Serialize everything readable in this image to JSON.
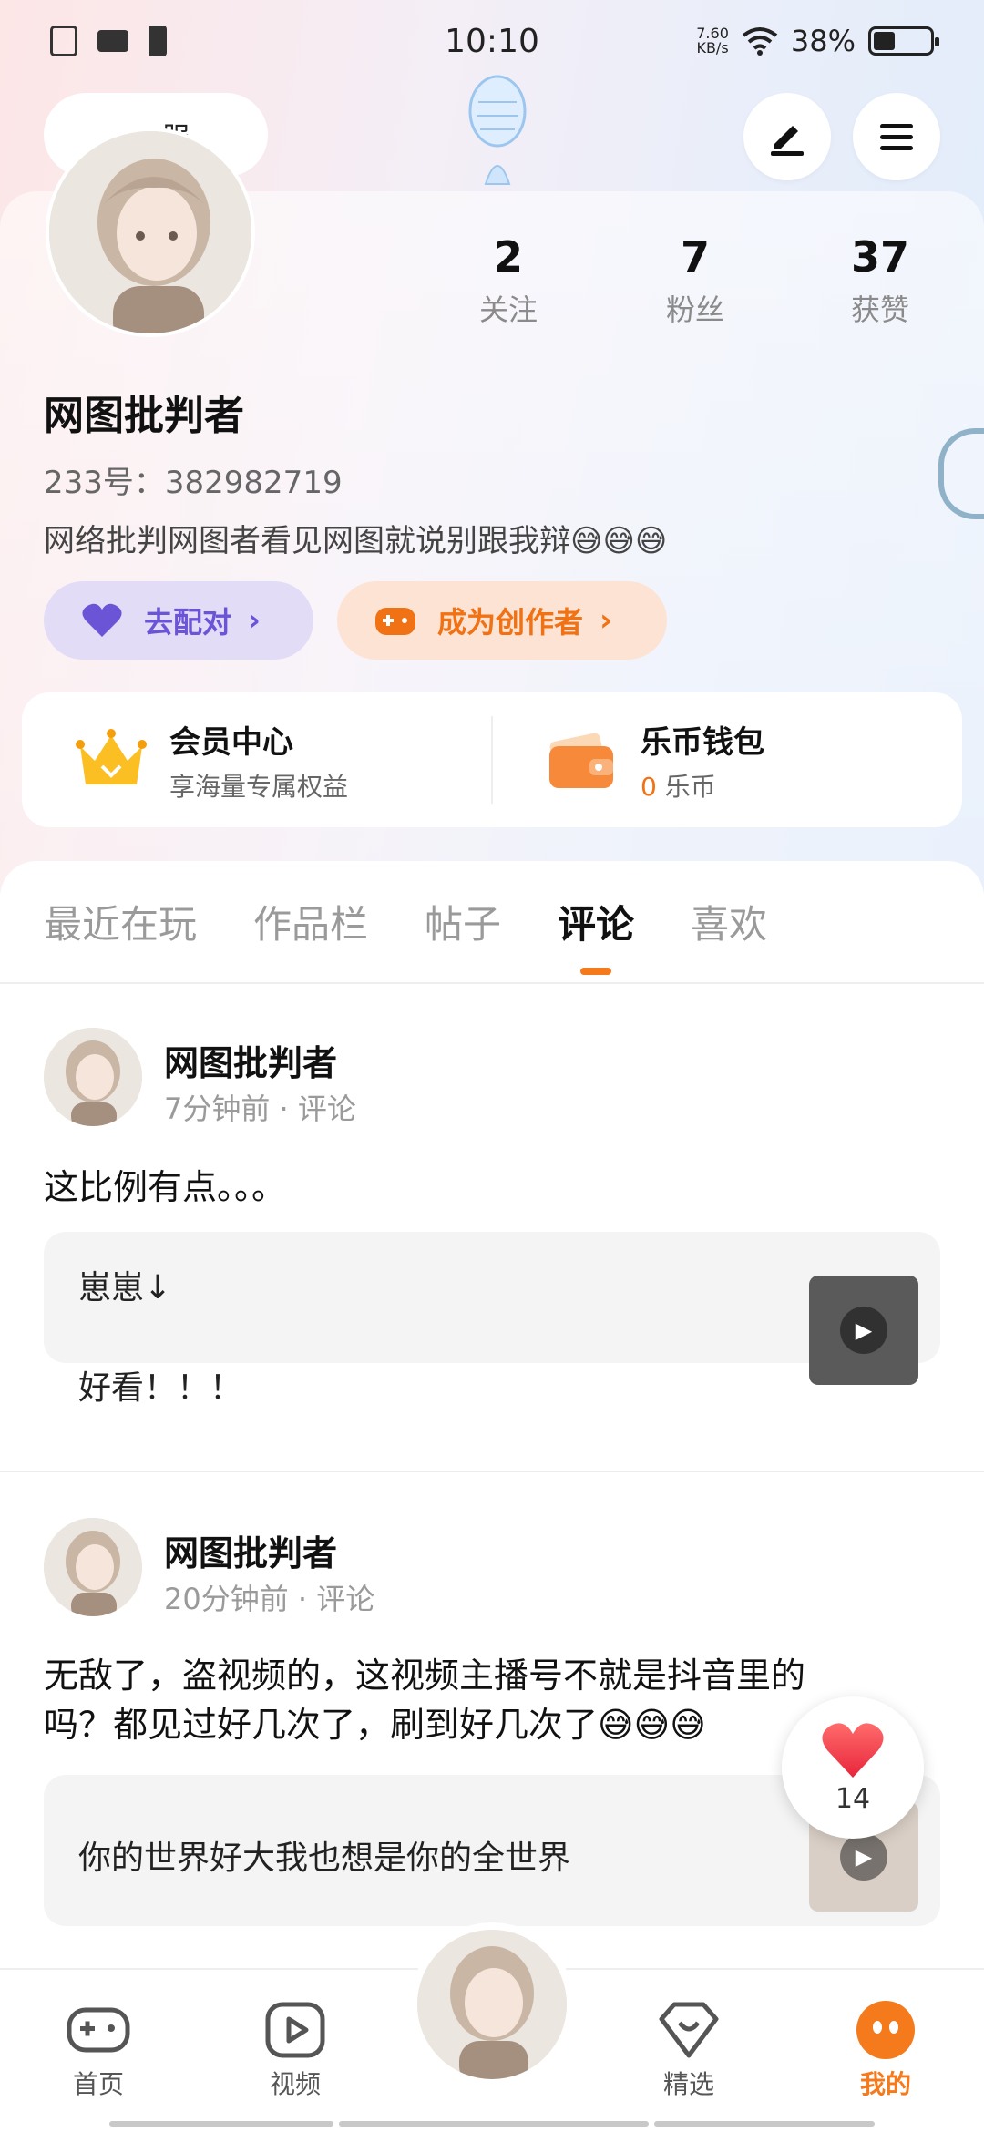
{
  "status_bar": {
    "time": "10:10",
    "net_speed_value": "7.60",
    "net_speed_unit": "KB/s",
    "battery": "38%",
    "battery_fraction": 0.38
  },
  "header": {
    "pill_label": "服"
  },
  "profile": {
    "stats": [
      {
        "value": "2",
        "label": "关注"
      },
      {
        "value": "7",
        "label": "粉丝"
      },
      {
        "value": "37",
        "label": "获赞"
      }
    ],
    "username": "网图批判者",
    "uid": "233号：382982719",
    "bio": "网络批判网图者看见网图就说别跟我辩😅😅😅",
    "pair_button": "去配对",
    "creator_button": "成为创作者",
    "vip": {
      "title": "会员中心",
      "subtitle": "享海量专属权益"
    },
    "wallet": {
      "title": "乐币钱包",
      "amount": "0",
      "unit": "乐币"
    }
  },
  "tabs": [
    "最近在玩",
    "作品栏",
    "帖子",
    "评论",
    "喜欢"
  ],
  "active_tab": "评论",
  "posts": [
    {
      "author": "网图批判者",
      "time": "7分钟前",
      "type": "评论",
      "text": "这比例有点。。。",
      "quote_lines": [
        "崽崽↓",
        "好看！！！"
      ]
    },
    {
      "author": "网图批判者",
      "time": "20分钟前",
      "type": "评论",
      "text_line1": "无敌了，盗视频的，这视频主播号不就是抖音里的",
      "text_line2": "吗？都见过好几次了，刷到好几次了😅😅😅",
      "quote_lines": [
        "你的世界好大我也想是你的全世界"
      ]
    }
  ],
  "like_button": {
    "count": "14"
  },
  "bottom_nav": [
    {
      "label": "首页",
      "icon": "gamepad-icon"
    },
    {
      "label": "视频",
      "icon": "video-play-icon"
    },
    {
      "label": "精选",
      "icon": "heart-diamond-icon"
    },
    {
      "label": "我的",
      "icon": "face-icon"
    }
  ],
  "colors": {
    "accent": "#f47a1b",
    "pair": "#6b55d6"
  }
}
